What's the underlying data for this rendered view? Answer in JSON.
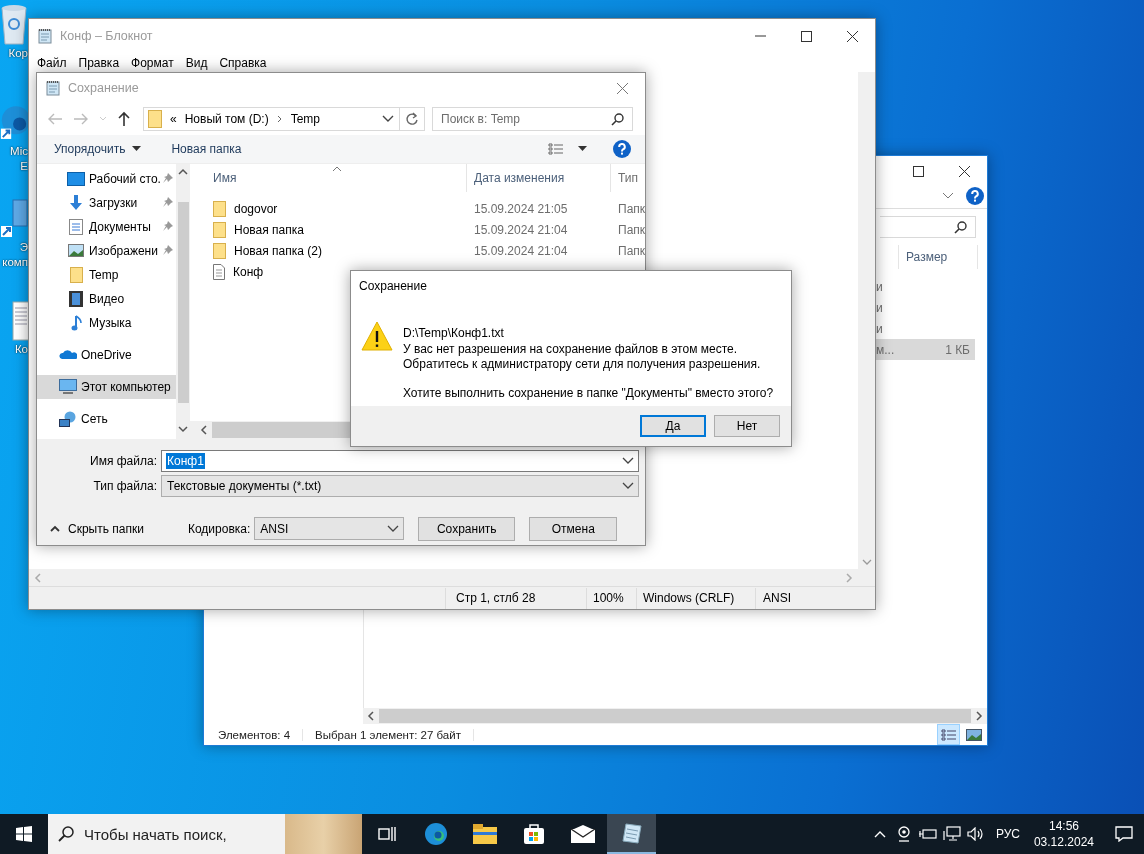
{
  "desktop_icons": [
    {
      "kind": "recycle-bin",
      "lines": [
        "Кор"
      ]
    },
    {
      "kind": "edge",
      "lines": [
        "Mic",
        "E"
      ]
    },
    {
      "kind": "computer",
      "lines": [
        "Э",
        "комп"
      ]
    },
    {
      "kind": "text-file",
      "lines": [
        "Ко"
      ]
    }
  ],
  "explorer": {
    "size_header": "Размер",
    "rows": [
      {
        "type": "и",
        "selected": false
      },
      {
        "type": "и",
        "selected": false
      },
      {
        "type": "и",
        "selected": false
      },
      {
        "type": "м...",
        "size": "1 КБ",
        "selected": true
      }
    ],
    "status": [
      "Элементов: 4",
      "Выбран 1 элемент: 27 байт"
    ],
    "views": [
      {
        "kind": "details",
        "selected": true
      },
      {
        "kind": "tiles",
        "selected": false
      }
    ]
  },
  "notepad": {
    "title": "Конф – Блокнот",
    "menu": [
      "Файл",
      "Правка",
      "Формат",
      "Вид",
      "Справка"
    ],
    "status_bar": [
      "Стр 1, стлб 28",
      "100%",
      "Windows (CRLF)",
      "ANSI"
    ]
  },
  "save_dialog": {
    "title": "Сохранение",
    "overflow": "«",
    "breadcrumb": [
      "Новый том (D:)",
      "Temp"
    ],
    "search_placeholder": "Поиск в: Temp",
    "organize": "Упорядочить",
    "new_folder": "Новая папка",
    "nav": [
      {
        "items": [
          {
            "label": "Рабочий сто.",
            "kind": "desktop",
            "pinned": true,
            "selected": false
          },
          {
            "label": "Загрузки",
            "kind": "downloads",
            "pinned": true,
            "selected": false
          },
          {
            "label": "Документы",
            "kind": "documents",
            "pinned": true,
            "selected": false
          },
          {
            "label": "Изображени",
            "kind": "pictures",
            "pinned": true,
            "selected": false
          },
          {
            "label": "Temp",
            "kind": "folder",
            "pinned": false,
            "selected": false
          },
          {
            "label": "Видео",
            "kind": "video",
            "pinned": false,
            "selected": false
          },
          {
            "label": "Музыка",
            "kind": "music",
            "pinned": false,
            "selected": false
          }
        ]
      },
      {
        "items": [
          {
            "label": "OneDrive",
            "kind": "onedrive",
            "pinned": false,
            "selected": false
          }
        ]
      },
      {
        "items": [
          {
            "label": "Этот компьютер",
            "kind": "computer",
            "pinned": false,
            "selected": true
          }
        ]
      },
      {
        "items": [
          {
            "label": "Сеть",
            "kind": "network",
            "pinned": false,
            "selected": false
          }
        ]
      }
    ],
    "columns": [
      "Имя",
      "Дата изменения",
      "Тип"
    ],
    "files": [
      {
        "name": "dogovor",
        "kind": "folder",
        "date": "15.09.2024 21:05",
        "type": "Папк"
      },
      {
        "name": "Новая папка",
        "kind": "folder",
        "date": "15.09.2024 21:04",
        "type": "Папк"
      },
      {
        "name": "Новая папка (2)",
        "kind": "folder",
        "date": "15.09.2024 21:04",
        "type": "Папк"
      },
      {
        "name": "Конф",
        "kind": "text"
      }
    ],
    "filename_label": "Имя файла:",
    "filename": "Конф1",
    "filename_selected": true,
    "filetype_label": "Тип файла:",
    "filetype": "Текстовые документы (*.txt)",
    "hide_folders": "Скрыть папки",
    "encoding_label": "Кодировка:",
    "encoding": "ANSI",
    "buttons": [
      "Сохранить",
      "Отмена"
    ]
  },
  "message_box": {
    "title": "Сохранение",
    "path": "D:\\Temp\\Конф1.txt",
    "lines": [
      "У вас нет разрешения на сохранение файлов в этом месте.",
      "Обратитесь к администратору сети для получения разрешения."
    ],
    "question": "Хотите выполнить сохранение в папке \"Документы\" вместо этого?",
    "buttons": [
      {
        "label": "Да",
        "default": true
      },
      {
        "label": "Нет",
        "default": false
      }
    ]
  },
  "taskbar": {
    "search_placeholder": "Чтобы начать поиск,",
    "apps": [
      {
        "kind": "task-view",
        "active": false
      },
      {
        "kind": "edge",
        "active": false
      },
      {
        "kind": "explorer",
        "active": false
      },
      {
        "kind": "store",
        "active": false
      },
      {
        "kind": "mail",
        "active": false
      },
      {
        "kind": "notepad",
        "active": true
      }
    ],
    "language": "РУС",
    "time": "14:56",
    "date": "03.12.2024"
  }
}
